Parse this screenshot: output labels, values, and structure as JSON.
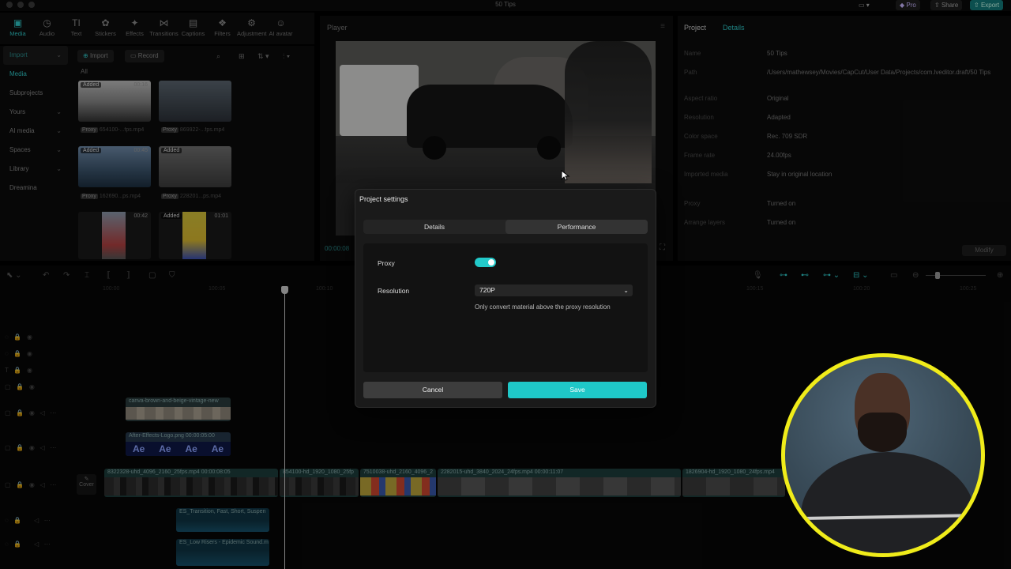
{
  "window": {
    "title": "50 Tips"
  },
  "titlebar": {
    "pro": "Pro",
    "share": "Share",
    "export": "Export"
  },
  "tools": [
    {
      "label": "Media",
      "icon": "▣"
    },
    {
      "label": "Audio",
      "icon": "◷"
    },
    {
      "label": "Text",
      "icon": "TI"
    },
    {
      "label": "Stickers",
      "icon": "✿"
    },
    {
      "label": "Effects",
      "icon": "✦"
    },
    {
      "label": "Transitions",
      "icon": "⋈"
    },
    {
      "label": "Captions",
      "icon": "▤"
    },
    {
      "label": "Filters",
      "icon": "❖"
    },
    {
      "label": "Adjustment",
      "icon": "⚙"
    },
    {
      "label": "AI avatar",
      "icon": "☺"
    }
  ],
  "sidebar": {
    "items": [
      {
        "label": "Import"
      },
      {
        "label": "Media"
      },
      {
        "label": "Subprojects"
      },
      {
        "label": "Yours"
      },
      {
        "label": "AI media"
      },
      {
        "label": "Spaces"
      },
      {
        "label": "Library"
      },
      {
        "label": "Dreamina"
      }
    ]
  },
  "media": {
    "import_label": "Import",
    "record_label": "Record",
    "all_label": "All",
    "thumbs": [
      {
        "tag": "Added",
        "dur": "00:16",
        "name": "654100-...fps.mp4",
        "proxy": "Proxy"
      },
      {
        "tag": "",
        "dur": "",
        "name": "869922-...fps.mp4",
        "proxy": "Proxy"
      },
      {
        "tag": "Added",
        "dur": "00:45",
        "name": "162690...ps.mp4",
        "proxy": "Proxy"
      },
      {
        "tag": "Added",
        "dur": "",
        "name": "228201...ps.mp4",
        "proxy": "Proxy"
      },
      {
        "tag": "",
        "dur": "00:42",
        "name": "",
        "proxy": ""
      },
      {
        "tag": "Added",
        "dur": "01:01",
        "name": "",
        "proxy": ""
      }
    ]
  },
  "player": {
    "title": "Player",
    "time": "00:00:08"
  },
  "details": {
    "tab_project": "Project",
    "tab_details": "Details",
    "rows": [
      {
        "key": "Name",
        "value": "50 Tips"
      },
      {
        "key": "Path",
        "value": "/Users/mathewsey/Movies/CapCut/User Data/Projects/com.lveditor.draft/50 Tips"
      },
      {
        "key": "Aspect ratio",
        "value": "Original"
      },
      {
        "key": "Resolution",
        "value": "Adapted"
      },
      {
        "key": "Color space",
        "value": "Rec. 709 SDR"
      },
      {
        "key": "Frame rate",
        "value": "24.00fps"
      },
      {
        "key": "Imported media",
        "value": "Stay in original location"
      },
      {
        "key": "Proxy",
        "value": "Turned on"
      },
      {
        "key": "Arrange layers",
        "value": "Turned on"
      }
    ],
    "modify_label": "Modify"
  },
  "timeline": {
    "ruler": [
      "100:00",
      "100:05",
      "100:10",
      "100:15",
      "100:20",
      "100:25"
    ],
    "cover_label": "Cover",
    "clips": {
      "sticker": "canva-brown-and-beige-vintage-new",
      "logo": "After-Effects-Logo.png  00:00:05:00",
      "logo_glyph": "Ae",
      "main1": "8322328-uhd_4096_2160_25fps.mp4  00:00:08:05",
      "main2": "854100-hd_1920_1080_25fp",
      "main3": "7510038-uhd_2160_4096_2",
      "main4": "2282015-uhd_3840_2024_24fps.mp4  00:00:11:07",
      "main5": "1826904-hd_1920_1080_24fps.mp4",
      "audio1": "ES_Transition, Fast, Short, Suspen",
      "audio2": "ES_Low Risers - Epidemic Sound.m"
    }
  },
  "modal": {
    "title": "Project settings",
    "tab_details": "Details",
    "tab_performance": "Performance",
    "proxy_label": "Proxy",
    "proxy_on": true,
    "resolution_label": "Resolution",
    "resolution_value": "720P",
    "resolution_hint": "Only convert material above the proxy resolution",
    "cancel_label": "Cancel",
    "save_label": "Save"
  },
  "colors": {
    "accent": "#1fc8c8",
    "webcam_ring": "#f0ec1a"
  }
}
